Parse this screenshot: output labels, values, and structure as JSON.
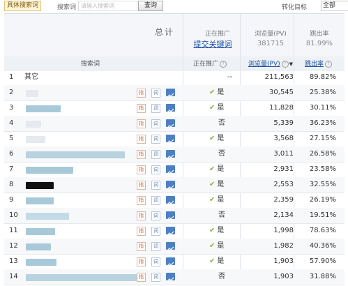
{
  "topbar": {
    "tag_label": "具体搜索词",
    "search_label": "搜索词",
    "search_placeholder": "请输入搜索词",
    "query_button": "查询",
    "right_label": "转化目标",
    "right_select": "全部"
  },
  "summary": {
    "total_label": "总计",
    "promoting_header": "正在推广",
    "submit_link": "提交关键词",
    "pv_header": "浏览量(PV)",
    "pv_total": "381715",
    "bounce_header": "跳出率",
    "bounce_total": "81.99%"
  },
  "table_header": {
    "keyword": "搜索词",
    "promoting": "正在推广",
    "pv": "浏览量(PV)",
    "bounce": "跳出率"
  },
  "row_buttons": {
    "zhi": "指",
    "ci": "词"
  },
  "colors": {
    "link": "#1a4fa3",
    "trend_button": "#4d7fc4",
    "check": "#8cb040"
  },
  "rows": [
    {
      "idx": "1",
      "keyword": "其它",
      "promoting": "--",
      "pv": "211,563",
      "bounce": "89.82%"
    },
    {
      "idx": "2",
      "keyword": "",
      "promoting": "是",
      "pv": "30,545",
      "bounce": "25.38%"
    },
    {
      "idx": "3",
      "keyword": "",
      "promoting": "是",
      "pv": "11,828",
      "bounce": "30.11%"
    },
    {
      "idx": "4",
      "keyword": "",
      "promoting": "否",
      "pv": "5,339",
      "bounce": "36.23%"
    },
    {
      "idx": "5",
      "keyword": "",
      "promoting": "是",
      "pv": "3,568",
      "bounce": "27.15%"
    },
    {
      "idx": "6",
      "keyword": "",
      "promoting": "否",
      "pv": "3,011",
      "bounce": "26.58%"
    },
    {
      "idx": "7",
      "keyword": "",
      "promoting": "是",
      "pv": "2,931",
      "bounce": "23.58%"
    },
    {
      "idx": "8",
      "keyword": "",
      "promoting": "是",
      "pv": "2,553",
      "bounce": "32.55%"
    },
    {
      "idx": "9",
      "keyword": "",
      "promoting": "是",
      "pv": "2,359",
      "bounce": "26.19%"
    },
    {
      "idx": "10",
      "keyword": "",
      "promoting": "否",
      "pv": "2,134",
      "bounce": "19.51%"
    },
    {
      "idx": "11",
      "keyword": "",
      "promoting": "是",
      "pv": "1,998",
      "bounce": "78.63%"
    },
    {
      "idx": "12",
      "keyword": "",
      "promoting": "是",
      "pv": "1,982",
      "bounce": "40.36%"
    },
    {
      "idx": "13",
      "keyword": "",
      "promoting": "是",
      "pv": "1,903",
      "bounce": "57.90%"
    },
    {
      "idx": "14",
      "keyword": "",
      "promoting": "否",
      "pv": "1,903",
      "bounce": "31.88%"
    }
  ]
}
